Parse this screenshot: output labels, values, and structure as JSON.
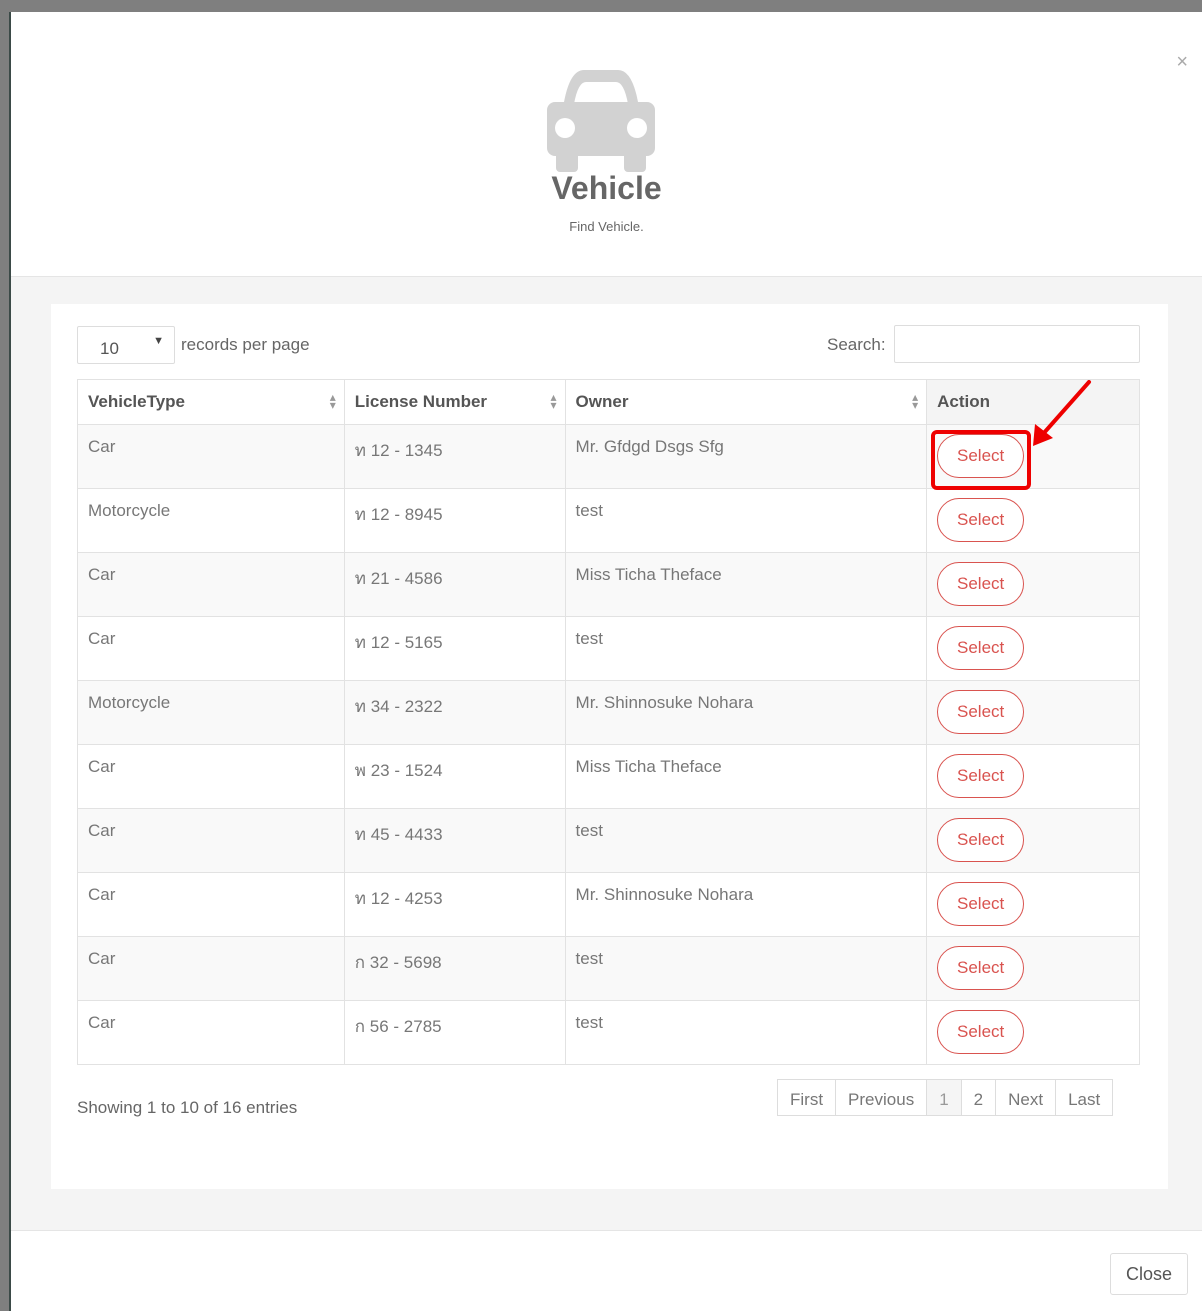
{
  "dialog": {
    "close_icon": "×",
    "icon": "car-icon",
    "title": "Vehicle",
    "subtitle": "Find Vehicle."
  },
  "table_controls": {
    "page_length": "10",
    "length_label": "records per page",
    "search_label": "Search:",
    "search_value": ""
  },
  "table": {
    "headers": [
      "VehicleType",
      "License Number",
      "Owner",
      "Action"
    ],
    "rows": [
      {
        "type": "Car",
        "plate": "ท 12 - 1345",
        "owner": "Mr. Gfdgd Dsgs Sfg",
        "action": "Select"
      },
      {
        "type": "Motorcycle",
        "plate": "ท 12 - 8945",
        "owner": "test",
        "action": "Select"
      },
      {
        "type": "Car",
        "plate": "ท 21 - 4586",
        "owner": "Miss Ticha Theface",
        "action": "Select"
      },
      {
        "type": "Car",
        "plate": "ท 12 - 5165",
        "owner": "test",
        "action": "Select"
      },
      {
        "type": "Motorcycle",
        "plate": "ท 34 - 2322",
        "owner": "Mr. Shinnosuke Nohara",
        "action": "Select"
      },
      {
        "type": "Car",
        "plate": "พ 23 - 1524",
        "owner": "Miss Ticha Theface",
        "action": "Select"
      },
      {
        "type": "Car",
        "plate": "ท 45 - 4433",
        "owner": "test",
        "action": "Select"
      },
      {
        "type": "Car",
        "plate": "ท 12 - 4253",
        "owner": "Mr. Shinnosuke Nohara",
        "action": "Select"
      },
      {
        "type": "Car",
        "plate": "ก 32 - 5698",
        "owner": "test",
        "action": "Select"
      },
      {
        "type": "Car",
        "plate": "ก 56 - 2785",
        "owner": "test",
        "action": "Select"
      }
    ]
  },
  "footer_info": "Showing 1 to 10 of 16 entries",
  "pagination": [
    "First",
    "Previous",
    "1",
    "2",
    "Next",
    "Last"
  ],
  "pagination_active": "1",
  "close_label": "Close",
  "colors": {
    "accent_red": "#d9534f",
    "annotation_red": "#ee0000"
  }
}
